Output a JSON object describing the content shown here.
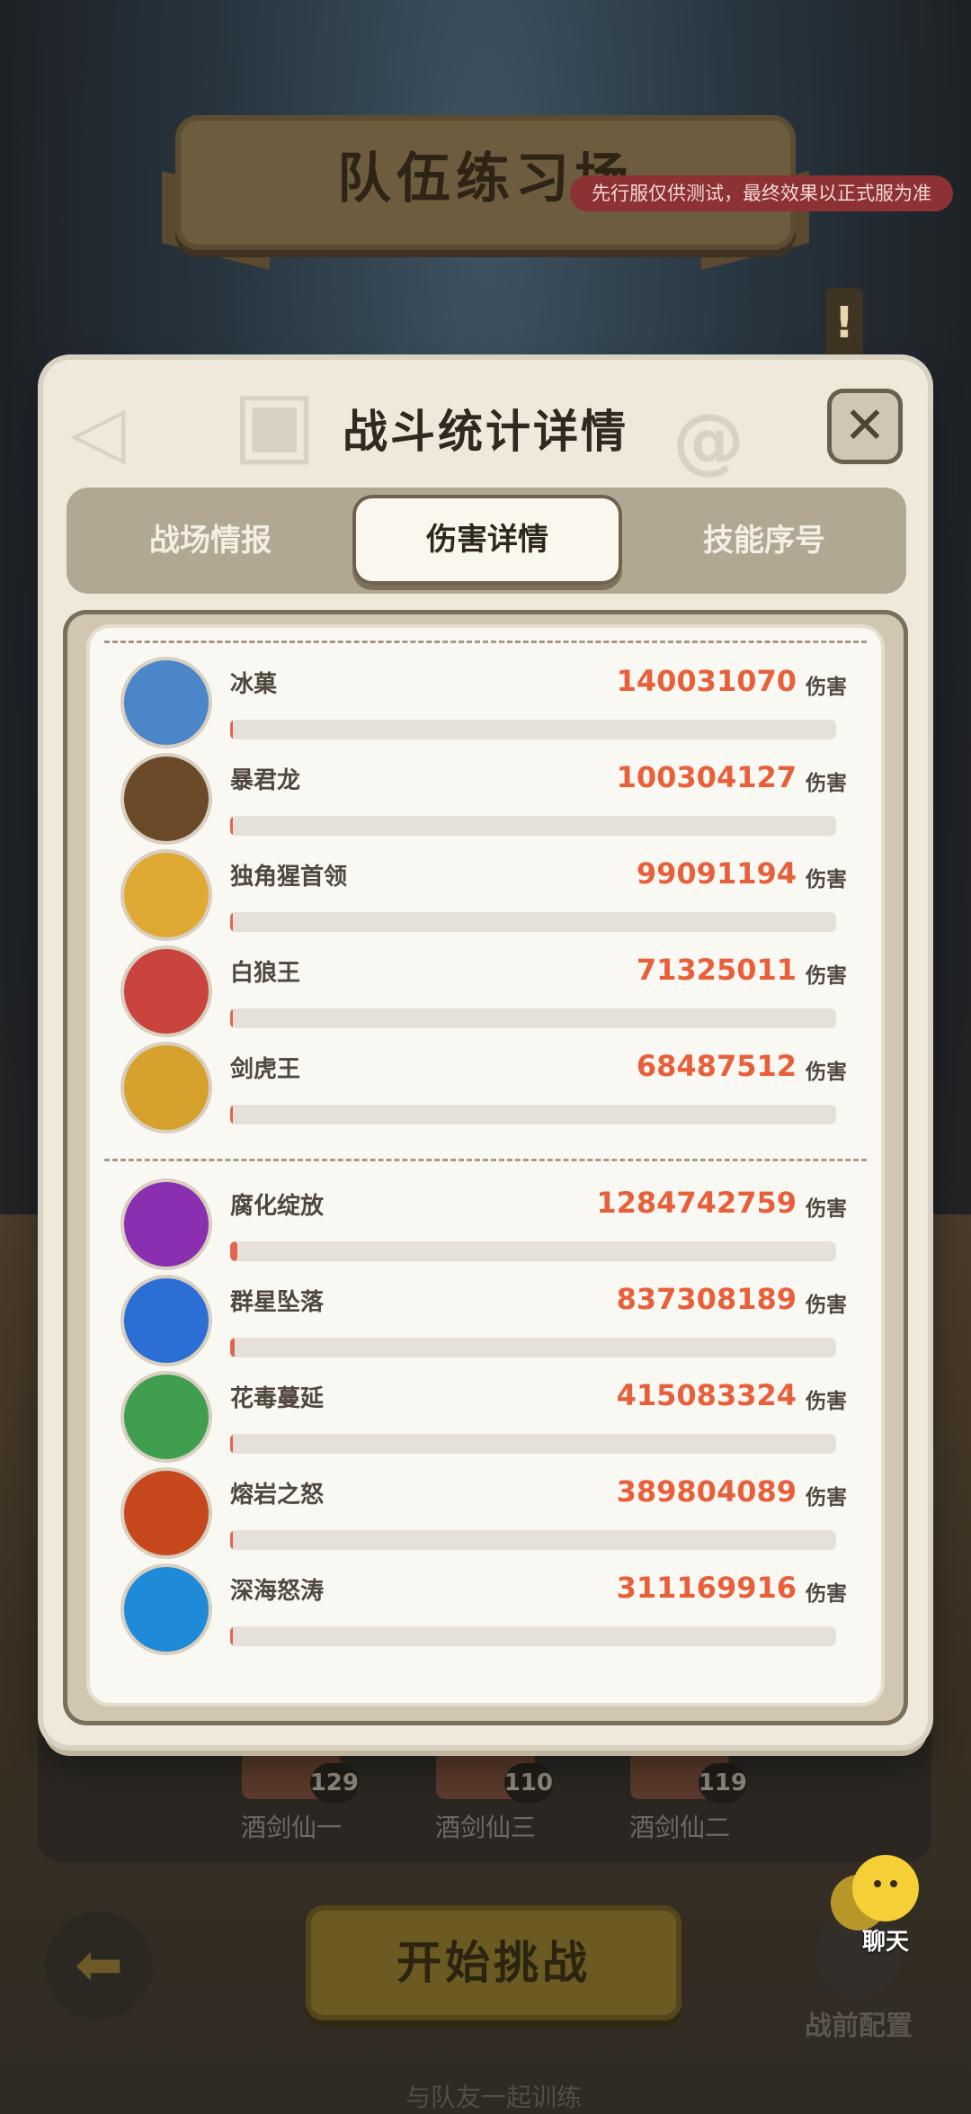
{
  "background": {
    "banner_title": "队伍练习场",
    "test_notice": "先行服仅供测试，最终效果以正式服为准",
    "team": [
      {
        "name": "酒剑仙一",
        "level": "129"
      },
      {
        "name": "酒剑仙三",
        "level": "110"
      },
      {
        "name": "酒剑仙二",
        "level": "119"
      }
    ],
    "start_button": "开始挑战",
    "train_hint": "与队友一起训练",
    "config_label": "战前配置",
    "chat_label": "聊天"
  },
  "modal": {
    "title": "战斗统计详情",
    "close_symbol": "✕",
    "tabs": [
      "战场情报",
      "伤害详情",
      "技能序号"
    ],
    "active_tab": "伤害详情",
    "unit": "伤害",
    "units": [
      {
        "name": "冰菓",
        "damage": "140031070",
        "share": 0.0,
        "icon": "blue-seal-avatar",
        "color": "#4a86c8"
      },
      {
        "name": "暴君龙",
        "damage": "100304127",
        "share": 0.0,
        "icon": "tyrant-dragon-avatar",
        "color": "#6b4a2a"
      },
      {
        "name": "独角猩首领",
        "damage": "99091194",
        "share": 0.0,
        "icon": "unicorn-ape-avatar",
        "color": "#e0a934"
      },
      {
        "name": "白狼王",
        "damage": "71325011",
        "share": 0.0,
        "icon": "white-wolf-avatar",
        "color": "#c9443c"
      },
      {
        "name": "剑虎王",
        "damage": "68487512",
        "share": 0.0,
        "icon": "saber-tiger-avatar",
        "color": "#d6a12c"
      }
    ],
    "skills": [
      {
        "name": "腐化绽放",
        "damage": "1284742759",
        "share": 0.012,
        "icon": "corruption-bloom-icon",
        "color": "#8a2fb0"
      },
      {
        "name": "群星坠落",
        "damage": "837308189",
        "share": 0.008,
        "icon": "falling-stars-icon",
        "color": "#2c6fd4"
      },
      {
        "name": "花毒蔓延",
        "damage": "415083324",
        "share": 0.004,
        "icon": "flower-poison-icon",
        "color": "#3f9f4f"
      },
      {
        "name": "熔岩之怒",
        "damage": "389804089",
        "share": 0.004,
        "icon": "lava-fury-icon",
        "color": "#c8481e"
      },
      {
        "name": "深海怒涛",
        "damage": "311169916",
        "share": 0.003,
        "icon": "deep-sea-wave-icon",
        "color": "#1e8ad8"
      }
    ]
  }
}
